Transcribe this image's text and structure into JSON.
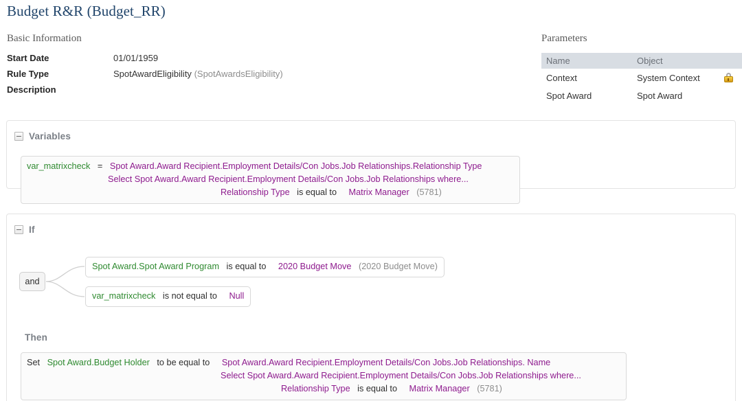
{
  "page": {
    "title": "Budget R&R (Budget_RR)"
  },
  "basic_information": {
    "caption": "Basic Information",
    "rows": [
      {
        "label": "Start Date",
        "value": "01/01/1959",
        "muted": ""
      },
      {
        "label": "Rule Type",
        "value": "SpotAwardEligibility",
        "muted": "(SpotAwardsEligibility)"
      },
      {
        "label": "Description",
        "value": "",
        "muted": ""
      }
    ]
  },
  "parameters": {
    "caption": "Parameters",
    "columns": [
      "Name",
      "Object"
    ],
    "rows": [
      {
        "name": "Context",
        "object": "System Context",
        "locked": true,
        "lock_icon": "lock-icon"
      },
      {
        "name": "Spot Award",
        "object": "Spot Award",
        "locked": false,
        "lock_icon": ""
      }
    ]
  },
  "variables_panel": {
    "title": "Variables",
    "toggle_icon": "collapse-minus-icon",
    "expression": {
      "name": "var_matrixcheck",
      "equals": "=",
      "line1_path": "Spot Award.Award Recipient.Employment Details/Con Jobs.Job Relationships.Relationship Type",
      "line2_select": "Select Spot Award.Award Recipient.Employment Details/Con Jobs.Job Relationships where...",
      "line3_field": "Relationship Type",
      "line3_operator": "is equal to",
      "line3_value": "Matrix Manager",
      "line3_value_id": "(5781)"
    }
  },
  "if_panel": {
    "title": "If",
    "toggle_icon": "collapse-minus-icon",
    "operator_node": "and",
    "conditions": [
      {
        "field": "Spot Award.Spot Award Program",
        "operator": "is equal to",
        "value": "2020 Budget Move",
        "value_id": "(2020 Budget Move)"
      },
      {
        "field": "var_matrixcheck",
        "operator": "is not equal to",
        "value": "Null",
        "value_id": ""
      }
    ],
    "then": {
      "label": "Then",
      "set_keyword": "Set",
      "target": "Spot Award.Budget Holder",
      "operator": "to be equal to",
      "line1_path": "Spot Award.Award Recipient.Employment Details/Con Jobs.Job Relationships. Name",
      "line2_select": "Select Spot Award.Award Recipient.Employment Details/Con Jobs.Job Relationships where...",
      "line3_field": "Relationship Type",
      "line3_operator": "is equal to",
      "line3_value": "Matrix Manager",
      "line3_value_id": "(5781)"
    }
  },
  "colors": {
    "title": "#21456b",
    "field_green": "#2f8a30",
    "value_purple": "#8e1b8e",
    "muted_grey": "#8d8d8d",
    "header_row_bg": "#d8dde3"
  }
}
